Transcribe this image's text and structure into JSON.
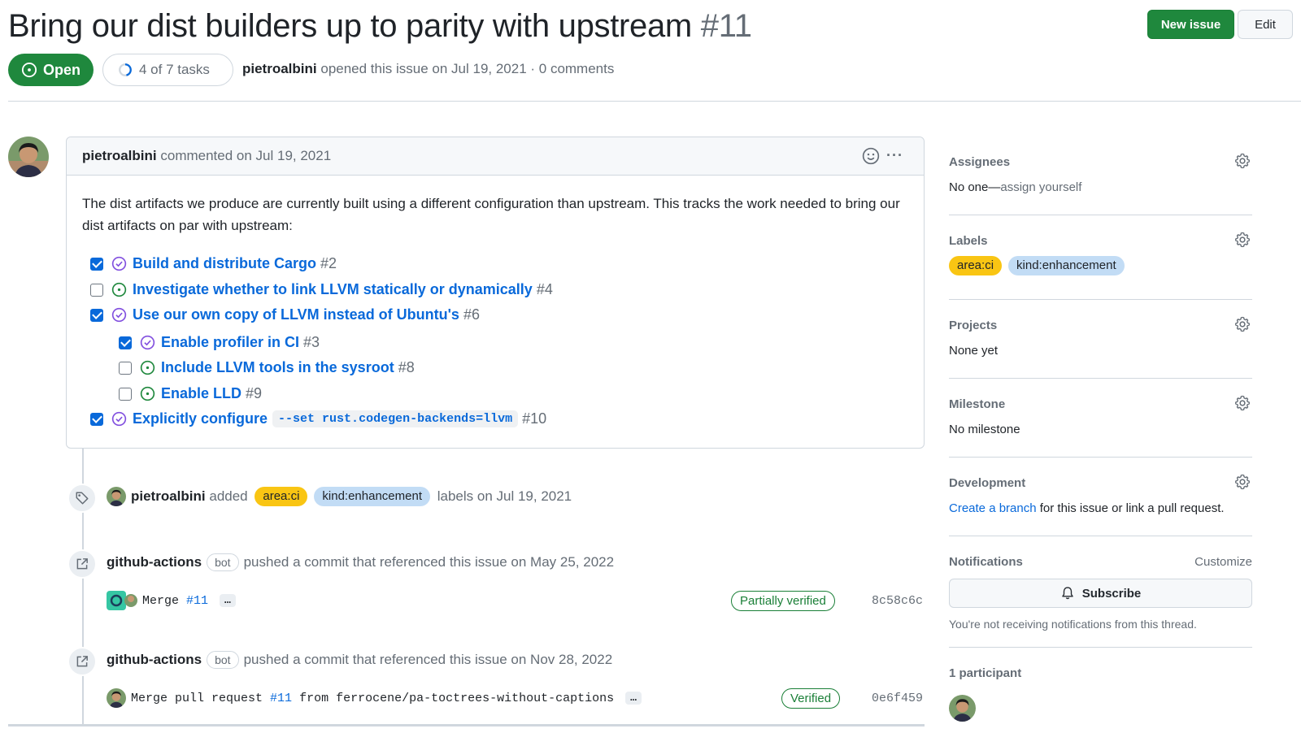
{
  "header": {
    "title": "Bring our dist builders up to parity with upstream",
    "number": "#11",
    "new_issue_label": "New issue",
    "edit_label": "Edit"
  },
  "meta": {
    "state": "Open",
    "tasks": "4 of 7 tasks",
    "author": "pietroalbini",
    "opened_text": "opened this issue on Jul 19, 2021 · 0 comments"
  },
  "comment": {
    "author": "pietroalbini",
    "date_text": "commented on Jul 19, 2021",
    "body": "The dist artifacts we produce are currently built using a different configuration than upstream. This tracks the work needed to bring our dist artifacts on par with upstream:",
    "tasks": [
      {
        "checked": true,
        "state": "closed",
        "title": "Build and distribute Cargo",
        "ref": "#2"
      },
      {
        "checked": false,
        "state": "open",
        "title": "Investigate whether to link LLVM statically or dynamically",
        "ref": "#4"
      },
      {
        "checked": true,
        "state": "closed",
        "title": "Use our own copy of LLVM instead of Ubuntu's",
        "ref": "#6"
      },
      {
        "checked": true,
        "state": "closed",
        "title": "Enable profiler in CI",
        "ref": "#3"
      },
      {
        "checked": false,
        "state": "open",
        "title": "Include LLVM tools in the sysroot",
        "ref": "#8"
      },
      {
        "checked": false,
        "state": "open",
        "title": "Enable LLD",
        "ref": "#9"
      },
      {
        "checked": true,
        "state": "closed",
        "title": "Explicitly configure",
        "code": "--set rust.codegen-backends=llvm",
        "ref": "#10"
      }
    ]
  },
  "timeline": {
    "label_event": {
      "actor": "pietroalbini",
      "verb": "added",
      "labels": [
        "area:ci",
        "kind:enhancement"
      ],
      "suffix": "labels on Jul 19, 2021"
    },
    "commit_events": [
      {
        "actor": "github-actions",
        "bot_tag": "bot",
        "text": "pushed a commit that referenced this issue on May 25, 2022",
        "commit_msg": "Merge",
        "commit_ref": "#11",
        "commit_rest": "",
        "ellipsis": "…",
        "verification": "Partially verified",
        "sha": "8c58c6c"
      },
      {
        "actor": "github-actions",
        "bot_tag": "bot",
        "text": "pushed a commit that referenced this issue on Nov 28, 2022",
        "commit_msg": "Merge pull request",
        "commit_ref": "#11",
        "commit_rest": "from ferrocene/pa-toctrees-without-captions",
        "ellipsis": "…",
        "verification": "Verified",
        "sha": "0e6f459"
      }
    ]
  },
  "sidebar": {
    "assignees": {
      "heading": "Assignees",
      "value": "No one—",
      "link": "assign yourself"
    },
    "labels": {
      "heading": "Labels",
      "items": [
        "area:ci",
        "kind:enhancement"
      ]
    },
    "projects": {
      "heading": "Projects",
      "value": "None yet"
    },
    "milestone": {
      "heading": "Milestone",
      "value": "No milestone"
    },
    "development": {
      "heading": "Development",
      "link": "Create a branch",
      "rest": "for this issue or link a pull request."
    },
    "notifications": {
      "heading": "Notifications",
      "customize": "Customize",
      "subscribe": "Subscribe",
      "note": "You're not receiving notifications from this thread."
    },
    "participants": {
      "heading": "1 participant"
    }
  },
  "colors": {
    "open_green": "#1f883d",
    "closed_purple": "#8250df",
    "link_blue": "#0969da",
    "label_ci": "#f9c513",
    "label_enhancement": "#c2dcf5"
  }
}
